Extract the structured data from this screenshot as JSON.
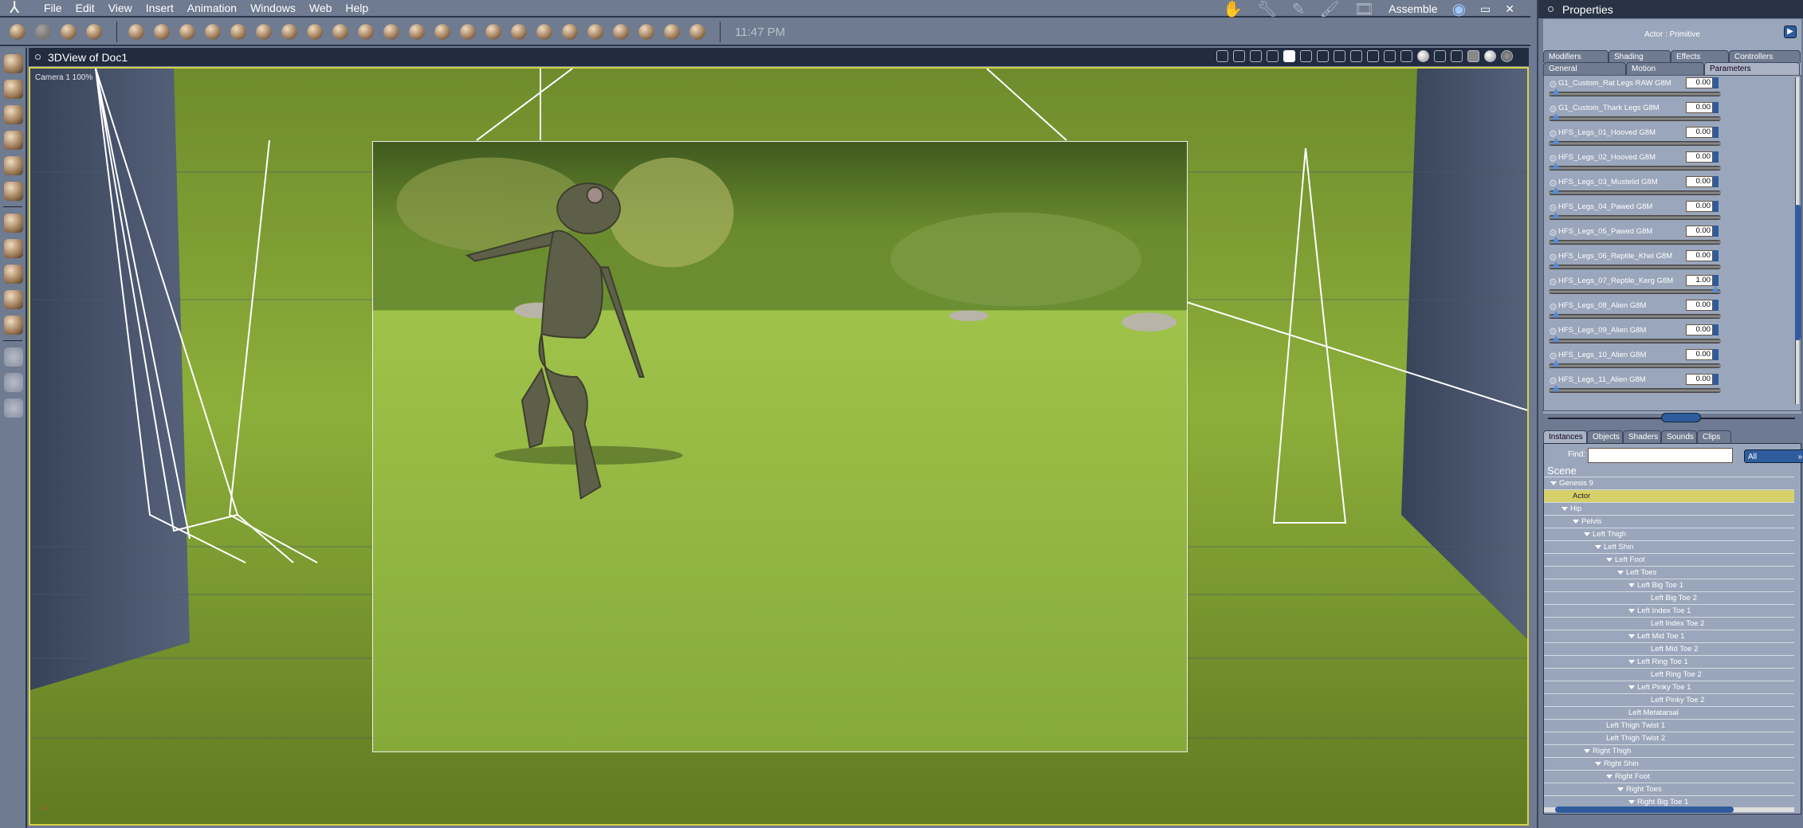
{
  "menu": {
    "items": [
      "File",
      "Edit",
      "View",
      "Insert",
      "Animation",
      "Windows",
      "Web",
      "Help"
    ]
  },
  "rooms": {
    "active": "Assemble",
    "icons": [
      "pose-hand-icon",
      "wrench-icon",
      "pencil-icon",
      "brush-icon",
      "film-icon"
    ]
  },
  "toolbar": {
    "clock": "11:47 PM"
  },
  "viewport": {
    "title": "3DView of Doc1",
    "camera_label": "Camera 1 100%"
  },
  "properties": {
    "title": "Properties",
    "actor_label": "Actor : Primitive",
    "tabs_row1": [
      "Modifiers",
      "Shading",
      "Effects",
      "Controllers"
    ],
    "tabs_row2": [
      "General",
      "Motion",
      "Parameters"
    ],
    "active_tab": "Parameters",
    "params": [
      {
        "label": "G1_Custom_Rat Legs RAW G8M",
        "value": "0.00",
        "level": 0
      },
      {
        "label": "G1_Custom_Thark Legs G8M",
        "value": "0.00",
        "level": 0
      },
      {
        "label": "HFS_Legs_01_Hooved G8M",
        "value": "0.00",
        "level": 0
      },
      {
        "label": "HFS_Legs_02_Hooved G8M",
        "value": "0.00",
        "level": 0
      },
      {
        "label": "HFS_Legs_03_Mustelid G8M",
        "value": "0.00",
        "level": 0
      },
      {
        "label": "HFS_Legs_04_Pawed G8M",
        "value": "0.00",
        "level": 0
      },
      {
        "label": "HFS_Legs_05_Pawed G8M",
        "value": "0.00",
        "level": 0
      },
      {
        "label": "HFS_Legs_06_Reptile_Khel G8M",
        "value": "0.00",
        "level": 0
      },
      {
        "label": "HFS_Legs_07_Reptile_Kerg G8M",
        "value": "1.00",
        "level": 1
      },
      {
        "label": "HFS_Legs_08_Alien G8M",
        "value": "0.00",
        "level": 0
      },
      {
        "label": "HFS_Legs_09_Alien G8M",
        "value": "0.00",
        "level": 0
      },
      {
        "label": "HFS_Legs_10_Alien G8M",
        "value": "0.00",
        "level": 0
      },
      {
        "label": "HFS_Legs_11_Alien G8M",
        "value": "0.00",
        "level": 0
      }
    ]
  },
  "scene": {
    "tabs": [
      "Instances",
      "Objects",
      "Shaders",
      "Sounds",
      "Clips"
    ],
    "active_tab": "Instances",
    "find_label": "Find:",
    "find_value": "",
    "filter": "All",
    "root": "Scene",
    "tree": [
      {
        "label": "Genesis 9",
        "depth": 0,
        "expand": true
      },
      {
        "label": "Actor",
        "depth": 1,
        "selected": true
      },
      {
        "label": "Hip",
        "depth": 1,
        "expand": true
      },
      {
        "label": "Pelvis",
        "depth": 2,
        "expand": true
      },
      {
        "label": "Left Thigh",
        "depth": 3,
        "expand": true
      },
      {
        "label": "Left Shin",
        "depth": 4,
        "expand": true
      },
      {
        "label": "Left Foot",
        "depth": 5,
        "expand": true
      },
      {
        "label": "Left Toes",
        "depth": 6,
        "expand": true
      },
      {
        "label": "Left Big Toe 1",
        "depth": 7,
        "expand": true
      },
      {
        "label": "Left Big Toe 2",
        "depth": 8
      },
      {
        "label": "Left Index Toe 1",
        "depth": 7,
        "expand": true
      },
      {
        "label": "Left Index Toe 2",
        "depth": 8
      },
      {
        "label": "Left Mid Toe 1",
        "depth": 7,
        "expand": true
      },
      {
        "label": "Left Mid Toe 2",
        "depth": 8
      },
      {
        "label": "Left Ring Toe 1",
        "depth": 7,
        "expand": true
      },
      {
        "label": "Left Ring Toe 2",
        "depth": 8
      },
      {
        "label": "Left Pinky Toe 1",
        "depth": 7,
        "expand": true
      },
      {
        "label": "Left Pinky Toe 2",
        "depth": 8
      },
      {
        "label": "Left Metatarsal",
        "depth": 6
      },
      {
        "label": "Left Thigh Twist 1",
        "depth": 4
      },
      {
        "label": "Left Thigh Twist 2",
        "depth": 4
      },
      {
        "label": "Right Thigh",
        "depth": 3,
        "expand": true
      },
      {
        "label": "Right Shin",
        "depth": 4,
        "expand": true
      },
      {
        "label": "Right Foot",
        "depth": 5,
        "expand": true
      },
      {
        "label": "Right Toes",
        "depth": 6,
        "expand": true
      },
      {
        "label": "Right Big Toe 1",
        "depth": 7,
        "expand": true
      }
    ]
  },
  "colors": {
    "accent": "#2e5c9e",
    "selection": "#d6d06a",
    "viewport_border": "#d8d24a"
  }
}
